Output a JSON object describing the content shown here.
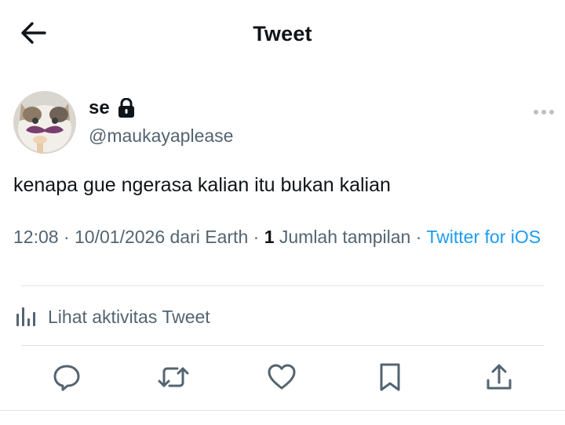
{
  "header": {
    "title": "Tweet",
    "back_icon": "arrow-left-icon"
  },
  "tweet": {
    "author": {
      "display_name": "se",
      "handle": "@maukayaplease",
      "protected": true,
      "avatar": "cat-with-mustache-avatar"
    },
    "text": "kenapa gue ngerasa kalian itu bukan kalian",
    "meta": {
      "time": "12:08",
      "separator": " · ",
      "date_location": "10/01/2026 dari Earth",
      "views_count": "1",
      "views_label": "Jumlah tampilan",
      "source": "Twitter for iOS"
    },
    "activity_label": "Lihat aktivitas Tweet"
  },
  "actions": [
    {
      "name": "reply",
      "icon": "reply-icon"
    },
    {
      "name": "retweet",
      "icon": "retweet-icon"
    },
    {
      "name": "like",
      "icon": "heart-icon"
    },
    {
      "name": "bookmark",
      "icon": "bookmark-icon"
    },
    {
      "name": "share",
      "icon": "share-icon"
    }
  ],
  "colors": {
    "text_primary": "#0f1419",
    "text_secondary": "#536471",
    "accent": "#1d9bf0",
    "divider": "#dfe3e6"
  }
}
